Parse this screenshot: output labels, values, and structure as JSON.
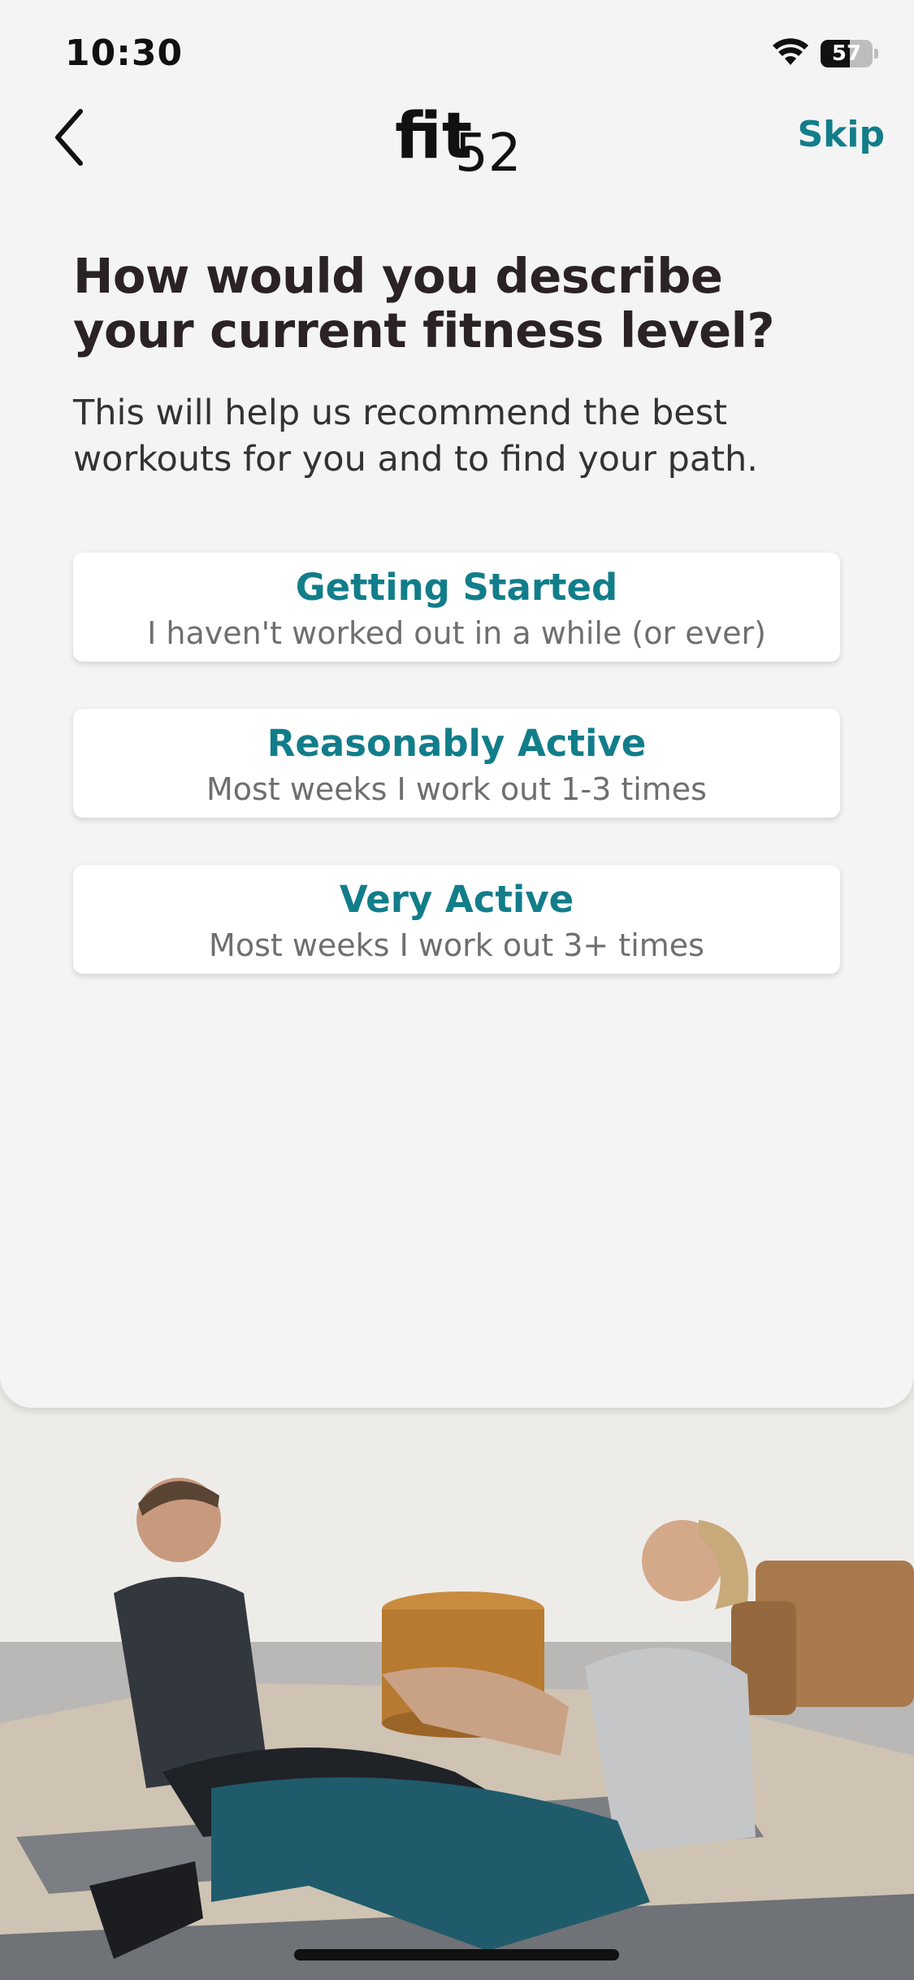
{
  "status_bar": {
    "time": "10:30",
    "battery_level": "57",
    "wifi_icon": "wifi-icon"
  },
  "nav": {
    "back_icon": "chevron-left-icon",
    "logo_main": "fit",
    "logo_number": "52",
    "skip_label": "Skip"
  },
  "question": {
    "title": "How would you describe your current fitness level?",
    "subtitle": "This will help us recommend the best workouts for you and to find your path."
  },
  "options": [
    {
      "title": "Getting Started",
      "description": "I haven't worked out in a while (or ever)"
    },
    {
      "title": "Reasonably Active",
      "description": "Most weeks I work out 1-3 times"
    },
    {
      "title": "Very Active",
      "description": "Most weeks I work out 3+ times"
    }
  ],
  "colors": {
    "accent": "#127d8a",
    "heading": "#2a2224",
    "card_background": "#f4f4f4",
    "option_background": "#ffffff"
  }
}
